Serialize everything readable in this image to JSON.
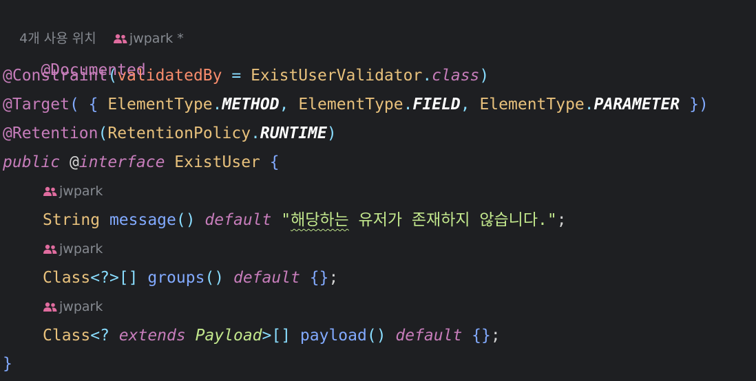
{
  "usage_hint": {
    "count_label": "4개 사용 위치",
    "author": "jwpark *"
  },
  "code": {
    "line1": {
      "annotation": "@Documented"
    },
    "line2": {
      "annotation": "@Constraint",
      "open": "(",
      "param_name": "validatedBy",
      "eq": " = ",
      "class_name": "ExistUserValidator",
      "dot": ".",
      "class_kw": "class",
      "close": ")"
    },
    "line3": {
      "annotation": "@Target",
      "open": "( { ",
      "type1": "ElementType",
      "dot1": ".",
      "const1": "METHOD",
      "comma1": ", ",
      "type2": "ElementType",
      "dot2": ".",
      "const2": "FIELD",
      "comma2": ", ",
      "type3": "ElementType",
      "dot3": ".",
      "const3": "PARAMETER",
      "close": " })"
    },
    "line4": {
      "annotation": "@Retention",
      "open": "(",
      "type": "RetentionPolicy",
      "dot": ".",
      "const": "RUNTIME",
      "close": ")"
    },
    "line5": {
      "kw_public": "public",
      "at": " @",
      "kw_interface": "interface",
      "name": " ExistUser ",
      "brace": "{"
    },
    "hint1": {
      "author": "jwpark"
    },
    "line6": {
      "type": "String",
      "method": " message",
      "parens": "()",
      "kw_default": " default ",
      "str_open": "\"",
      "str_squiggle": "해당하는",
      "str_rest": " 유저가 존재하지 않습니다.",
      "str_close": "\"",
      "semi": ";"
    },
    "hint2": {
      "author": "jwpark"
    },
    "line7": {
      "type": "Class",
      "generic": "<?>[]",
      "method": " groups",
      "parens": "()",
      "kw_default": " default ",
      "braces": "{}",
      "semi": ";"
    },
    "hint3": {
      "author": "jwpark"
    },
    "line8": {
      "type": "Class",
      "gen_open": "<? ",
      "kw_extends": "extends",
      "payload": " Payload",
      "gen_close": ">[]",
      "method": " payload",
      "parens": "()",
      "kw_default": " default ",
      "braces": "{}",
      "semi": ";"
    },
    "line9": {
      "brace": "}"
    }
  },
  "colors": {
    "background": "#1e1f22",
    "annotation": "#c77dbb",
    "keyword": "#c77dbb",
    "class": "#e8c17c",
    "method": "#82aaff",
    "string": "#c3e88d",
    "punctuation": "#89ddff",
    "hint": "#868a91",
    "user_icon": "#e06c9f"
  },
  "icons": {
    "author_hint": "users-icon"
  }
}
